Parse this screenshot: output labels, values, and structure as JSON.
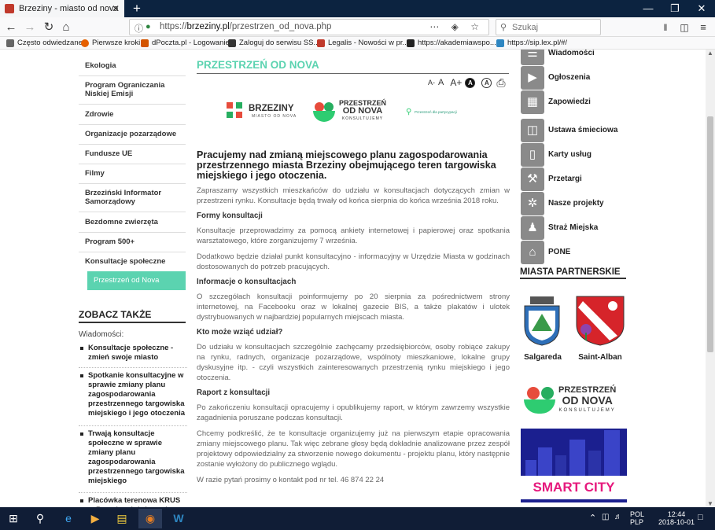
{
  "browser": {
    "tab_title": "Brzeziny - miasto od nova",
    "tab_close": "✕",
    "new_tab": "+",
    "window_controls": [
      "—",
      "❐",
      "✕"
    ],
    "url_prefix": "https://",
    "url_domain": "brzeziny.pl",
    "url_path": "/przestrzen_od_nova.php",
    "search_placeholder": "Szukaj",
    "url_tools": "⋯ ◈ ☆",
    "bookmarks": [
      "Często odwiedzane",
      "Pierwsze kroki",
      "dPoczta.pl - Logowanie",
      "Zaloguj do serwisu SS...",
      "Legalis - Nowości w pr...",
      "https://akademiawspo...",
      "https://sip.lex.pl/#/"
    ]
  },
  "left_nav": {
    "items": [
      "Ekologia",
      "Program Ograniczania Niskiej Emisji",
      "Zdrowie",
      "Organizacje pozarządowe",
      "Fundusze UE",
      "Filmy",
      "Brzeziński Informator Samorządowy",
      "Bezdomne zwierzęta",
      "Program 500+",
      "Konsultacje społeczne"
    ],
    "active_item": "Przestrzeń od Nova"
  },
  "see_also": {
    "title": "ZOBACZ TAKŻE",
    "label": "Wiadomości:",
    "items": [
      "Konsultacje społeczne - zmień swoje miasto",
      "Spotkanie konsultacyjne w sprawie zmiany planu zagospodarowania przestrzennego targowiska miejskiego i jego otoczenia",
      "Trwają konsultacje społeczne w sprawie zmiany planu zagospodarowania przestrzennego targowiska miejskiego",
      "Placówka terenowa KRUS w Brzezinach informuje"
    ]
  },
  "main": {
    "title": "PRZESTRZEŃ OD NOVA",
    "font_controls": [
      "A-",
      "A",
      "A+"
    ],
    "contrast_labels": [
      "A",
      "A"
    ],
    "print_icon": "⎙",
    "logos": {
      "brzeziny_name": "BRZEZINY",
      "brzeziny_sub": "MIASTO OD NOVA",
      "odnova_line1": "PRZESTRZEŃ",
      "odnova_line2": "OD NOVA",
      "odnova_line3": "KONSULTUJEMY",
      "partycypacja": "Przestrzeń dla partycypacji"
    },
    "heading": "Pracujemy nad zmianą miejscowego planu zagospodarowania przestrzennego miasta Brzeziny obejmującego teren targowiska miejskiego i jego otoczenia.",
    "intro": "Zapraszamy wszystkich mieszkańców do udziału w konsultacjach dotyczących zmian w przestrzeni rynku. Konsultacje będą trwały od końca sierpnia do końca września 2018 roku.",
    "h_formy": "Formy konsultacji",
    "p_formy1": "Konsultacje przeprowadzimy za pomocą ankiety internetowej i papierowej oraz spotkania warsztatowego, które zorganizujemy 7 września.",
    "p_formy2": "Dodatkowo będzie działał punkt konsultacyjno - informacyjny w Urzędzie Miasta w godzinach dostosowanych do potrzeb pracujących.",
    "h_info": "Informacje o konsultacjach",
    "p_info": "O szczegółach konsultacji poinformujemy po 20 sierpnia za pośrednictwem strony internetowej, na Facebooku oraz w lokalnej gazecie BIS, a także plakatów i ulotek dystrybuowanych w najbardziej popularnych miejscach miasta.",
    "h_kto": "Kto może wziąć udział?",
    "p_kto": "Do udziału w konsultacjach szczególnie zachęcamy przedsiębiorców, osoby robiące zakupy na rynku, radnych, organizacje pozarządowe, wspólnoty mieszkaniowe, lokalne grupy dyskusyjne itp. - czyli wszystkich zainteresowanych przestrzenią rynku miejskiego i jego otoczenia.",
    "h_raport": "Raport z konsultacji",
    "p_raport1": "Po zakończeniu konsultacji opracujemy i opublikujemy raport, w którym zawrzemy wszystkie zagadnienia poruszane podczas konsultacji.",
    "p_raport2": "Chcemy podkreślić, że te konsultacje organizujemy już na pierwszym etapie opracowania zmiany miejscowego planu. Tak więc zebrane głosy będą dokładnie analizowane przez zespół projektowy odpowiedzialny za stworzenie nowego dokumentu - projektu planu, który następnie zostanie wyłożony do publicznego wglądu.",
    "p_contact": "W razie pytań prosimy o kontakt pod nr tel. 46 874 22 24"
  },
  "right_menu": {
    "items": [
      {
        "label": "Wiadomości",
        "icon": "news-icon"
      },
      {
        "label": "Ogłoszenia",
        "icon": "megaphone-icon"
      },
      {
        "label": "Zapowiedzi",
        "icon": "calendar-icon"
      },
      {
        "label": "Ustawa śmieciowa",
        "icon": "trash-icon"
      },
      {
        "label": "Karty usług",
        "icon": "document-icon"
      },
      {
        "label": "Przetargi",
        "icon": "gavel-icon"
      },
      {
        "label": "Nasze projekty",
        "icon": "eu-stars-icon"
      },
      {
        "label": "Straż Miejska",
        "icon": "guard-icon"
      },
      {
        "label": "PONE",
        "icon": "house-icon"
      }
    ],
    "partners_title": "MIASTA PARTNERSKIE",
    "partners": [
      "Salgareda",
      "Saint-Alban"
    ],
    "odnova_line1": "PRZESTRZEŃ",
    "odnova_line2": "OD NOVA",
    "odnova_line3": "KONSULTUJEMY",
    "smart_city": "SMART CITY"
  },
  "taskbar": {
    "lang1": "POL",
    "lang2": "PLP",
    "time": "12:44",
    "date": "2018-10-01"
  },
  "colors": {
    "accent": "#5bd3b0",
    "icon_gray": "#8a8a8a",
    "titlebar": "#0c2340"
  }
}
